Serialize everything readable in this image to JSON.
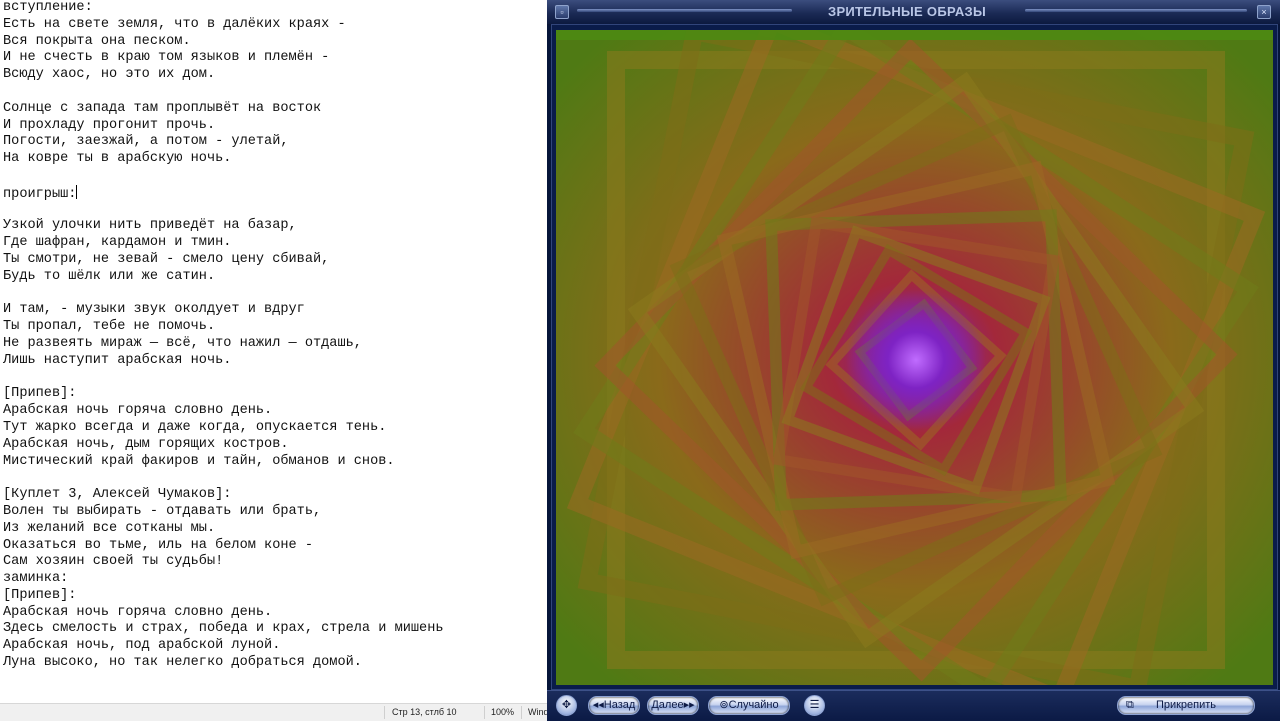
{
  "editor": {
    "lines": [
      "вступление:",
      "Есть на свете земля, что в далёких краях -",
      "Вся покрыта она песком.",
      "И не счесть в краю том языков и племён -",
      "Всюду хаос, но это их дом.",
      "",
      "Солнце с запада там проплывёт на восток",
      "И прохладу прогонит прочь.",
      "Погости, заезжай, а потом - улетай,",
      "На ковре ты в арабскую ночь.",
      "",
      "проигрыш:",
      "",
      "Узкой улочки нить приведёт на базар,",
      "Где шафран, кардамон и тмин.",
      "Ты смотри, не зевай - смело цену сбивай,",
      "Будь то шёлк или же сатин.",
      "",
      "И там, - музыки звук околдует и вдруг",
      "Ты пропал, тебе не помочь.",
      "Не развеять мираж — всё, что нажил — отдашь,",
      "Лишь наступит арабская ночь.",
      "",
      "[Припев]:",
      "Арабская ночь горяча словно день.",
      "Тут жарко всегда и даже когда, опускается тень.",
      "Арабская ночь, дым горящих костров.",
      "Мистический край факиров и тайн, обманов и снов.",
      "",
      "[Куплет 3, Алексей Чумаков]:",
      "Волен ты выбирать - отдавать или брать,",
      "Из желаний все сотканы мы.",
      "Оказаться во тьме, иль на белом коне -",
      "Сам хозяин своей ты судьбы!",
      "заминка:",
      "[Припев]:",
      "Арабская ночь горяча словно день.",
      "Здесь смелость и страх, победа и крах, стрела и мишень",
      "Арабская ночь, под арабской луной.",
      "Луна высоко, но так нелегко добраться домой."
    ]
  },
  "statusbar": {
    "position": "Стр 13, стлб 10",
    "zoom": "100%",
    "encoding_fragment": "Wind"
  },
  "player": {
    "title": "ЗРИТЕЛЬНЫЕ ОБРАЗЫ",
    "controls": {
      "back_label": "Назад",
      "next_label": "Далее",
      "random_label": "Случайно",
      "pin_label": "Прикрепить"
    },
    "colors": {
      "chrome": "#0b1a45",
      "viz_green": "#5b7a1a",
      "viz_red": "#9a2f1c",
      "viz_purple": "#6a1fb0"
    }
  }
}
